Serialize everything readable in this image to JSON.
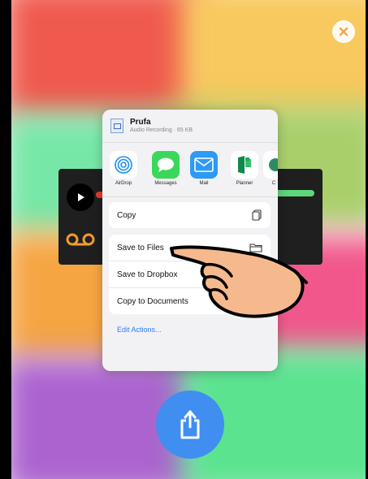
{
  "colors": {
    "red": "#f05a4e",
    "yellow": "#f8c95e",
    "green": "#5be38f",
    "orange": "#f6a543",
    "purple": "#ac63cf",
    "blue": "#3f8ef0",
    "link": "#2e7cf6"
  },
  "file": {
    "name": "Prufa",
    "meta": "Audio Recording · 65 KB",
    "icon": "audio-file-icon"
  },
  "apps": [
    {
      "label": "AirDrop",
      "icon": "airdrop-icon"
    },
    {
      "label": "Messages",
      "icon": "messages-icon"
    },
    {
      "label": "Mail",
      "icon": "mail-icon"
    },
    {
      "label": "Planner",
      "icon": "planner-icon"
    },
    {
      "label": "C",
      "icon": "app-icon"
    }
  ],
  "actions": {
    "group1": [
      {
        "label": "Copy",
        "icon": "copy-icon"
      }
    ],
    "group2": [
      {
        "label": "Save to Files",
        "icon": "folder-icon"
      },
      {
        "label": "Save to Dropbox",
        "icon": ""
      },
      {
        "label": "Copy to Documents",
        "icon": ""
      }
    ],
    "edit_label": "Edit Actions..."
  },
  "buttons": {
    "close": "close-icon",
    "share": "share-icon"
  }
}
